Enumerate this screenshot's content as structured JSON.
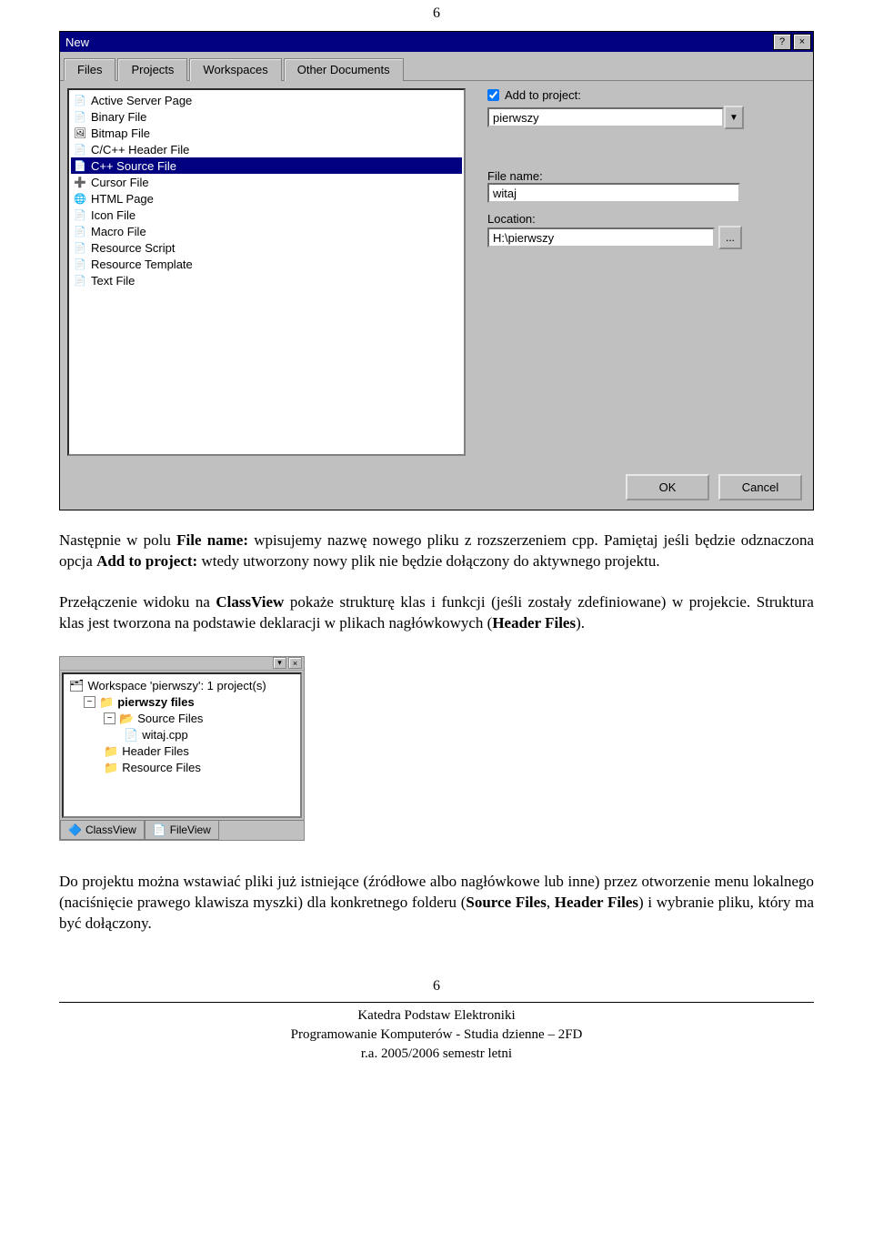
{
  "page_top_number": "6",
  "page_bottom_number": "6",
  "dialog": {
    "title": "New",
    "help_icon": "?",
    "close_icon": "×",
    "tabs": [
      "Files",
      "Projects",
      "Workspaces",
      "Other Documents"
    ],
    "filetypes": [
      "Active Server Page",
      "Binary File",
      "Bitmap File",
      "C/C++ Header File",
      "C++ Source File",
      "Cursor File",
      "HTML Page",
      "Icon File",
      "Macro File",
      "Resource Script",
      "Resource Template",
      "Text File"
    ],
    "selected_filetype_index": 4,
    "add_to_project_label": "Add to project:",
    "project_combo": "pierwszy",
    "file_name_label": "File name:",
    "file_name_value": "witaj",
    "location_label": "Location:",
    "location_value": "H:\\pierwszy",
    "browse_label": "...",
    "ok": "OK",
    "cancel": "Cancel"
  },
  "para1_pre": "Następnie w polu ",
  "para1_b1": "File name:",
  "para1_mid1": " wpisujemy nazwę nowego pliku z rozszerzeniem cpp. Pamiętaj jeśli będzie odznaczona opcja ",
  "para1_b2": "Add to project:",
  "para1_post": " wtedy utworzony nowy plik nie będzie dołączony do aktywnego projektu.",
  "para2_pre": "Przełączenie widoku na ",
  "para2_b1": "ClassView",
  "para2_mid1": " pokaże strukturę klas i funkcji (jeśli zostały zdefiniowane) w projekcie. Struktura klas jest tworzona na podstawie deklaracji w plikach nagłówkowych (",
  "para2_b2": "Header Files",
  "para2_post": ").",
  "fileview": {
    "workspace": "Workspace 'pierwszy': 1 project(s)",
    "project": "pierwszy files",
    "sourcefiles": "Source Files",
    "witaj": "witaj.cpp",
    "headerfiles": "Header Files",
    "resourcefiles": "Resource Files",
    "classview_tab": "ClassView",
    "fileview_tab": "FileView"
  },
  "para3_pre": "Do projektu można wstawiać pliki już istniejące (źródłowe albo nagłówkowe lub inne) przez otworzenie menu lokalnego (naciśnięcie prawego klawisza myszki) dla konkretnego folderu (",
  "para3_b1": "Source Files",
  "para3_mid": ", ",
  "para3_b2": "Header Files",
  "para3_post": ") i wybranie pliku, który ma być dołączony.",
  "footer": {
    "line1": "Katedra Podstaw Elektroniki",
    "line2": "Programowanie Komputerów - Studia dzienne – 2FD",
    "line3": "r.a. 2005/2006 semestr letni"
  }
}
